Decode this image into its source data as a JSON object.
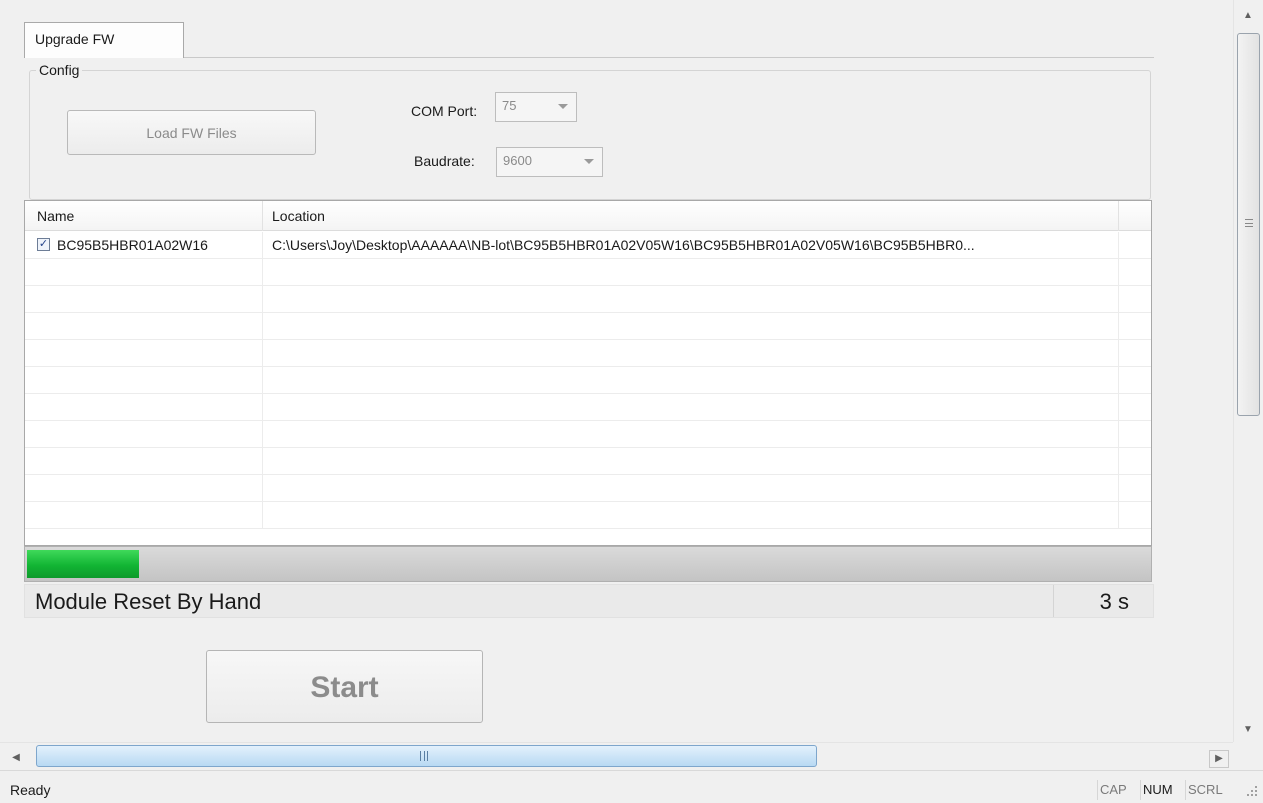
{
  "tabs": [
    {
      "label": "Upgrade FW",
      "active": true
    }
  ],
  "config": {
    "title": "Config",
    "load_button": "Load FW Files",
    "com_port": {
      "label": "COM Port:",
      "value": "75"
    },
    "baudrate": {
      "label": "Baudrate:",
      "value": "9600"
    }
  },
  "table": {
    "columns": [
      "Name",
      "Location"
    ],
    "rows": [
      {
        "checked": true,
        "name": "BC95B5HBR01A02W16",
        "location": "C:\\Users\\Joy\\Desktop\\AAAAAA\\NB-lot\\BC95B5HBR01A02V05W16\\BC95B5HBR01A02V05W16\\BC95B5HBR0..."
      }
    ],
    "empty_rows": 10
  },
  "progress": {
    "fraction": 0.1,
    "color": "#12b534"
  },
  "status": {
    "message": "Module Reset By Hand",
    "timer": "3 s"
  },
  "start_button": "Start",
  "statusbar": {
    "text": "Ready",
    "indicators": {
      "cap": "CAP",
      "num": "NUM",
      "scrl": "SCRL"
    }
  },
  "icons": {
    "scroll_up": "triangle-up",
    "scroll_down": "triangle-down",
    "scroll_left": "triangle-left",
    "scroll_right": "triangle-right"
  }
}
